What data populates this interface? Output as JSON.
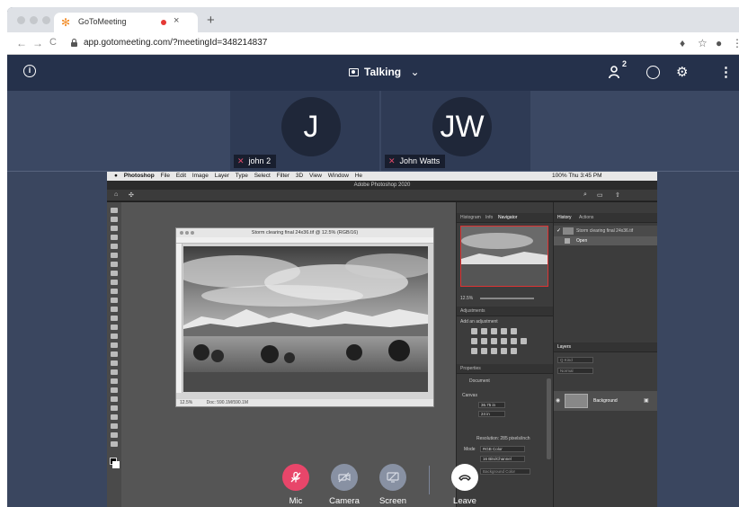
{
  "browser": {
    "tab_title": "GoToMeeting",
    "tab_close": "×",
    "new_tab": "+",
    "url": "app.gotomeeting.com/?meetingId=348214837",
    "nav": {
      "back": "←",
      "forward": "→",
      "reload": "C"
    },
    "actions": {
      "mic": "♦",
      "star": "☆",
      "account": "●",
      "menu": "⋮"
    }
  },
  "header": {
    "info": "i",
    "status_label": "Talking",
    "status_caret": "⌄",
    "participants_count": "2",
    "settings": "⚙",
    "more": "⋮"
  },
  "participants": [
    {
      "initials": "J",
      "name": "john 2",
      "mic_muted": true
    },
    {
      "initials": "JW",
      "name": "John Watts",
      "mic_muted": true
    }
  ],
  "shared_screen": {
    "menubar": [
      "Photoshop",
      "File",
      "Edit",
      "Image",
      "Layer",
      "Type",
      "Select",
      "Filter",
      "3D",
      "View",
      "Window",
      "He"
    ],
    "menubar_right": "100%  Thu 3:45 PM",
    "app_title": "Adobe Photoshop 2020",
    "doc_title": "Storm clearing final 24x36.tif @ 12.5% (RGB/16)",
    "doc_status_zoom": "12.5%",
    "doc_status_doc": "Doc: 590.1M/590.1M",
    "nav_tabs": [
      "Histogram",
      "Info",
      "Navigator"
    ],
    "nav_zoom": "12.5%",
    "adjustments_title": "Adjustments",
    "adjustments_hint": "Add an adjustment",
    "properties_title": "Properties",
    "properties_doc": "Document",
    "canvas_label": "Canvas",
    "canvas_w": "36.75 in",
    "canvas_h": "24 in",
    "resolution": "Resolution: 285 pixels/inch",
    "mode_label": "Mode",
    "mode_value": "RGB Color",
    "depth_value": "16 Bits/Channel",
    "bg_label": "Background Color",
    "history_tabs": [
      "History",
      "Actions"
    ],
    "history_items": [
      "Storm clearing final 24x36.tif",
      "Open"
    ],
    "layers_title": "Layers",
    "layer_name": "Background"
  },
  "controls": [
    {
      "label": "Mic",
      "color": "#e8466a",
      "state": "muted"
    },
    {
      "label": "Camera",
      "color": "#8891a3",
      "state": "off"
    },
    {
      "label": "Screen",
      "color": "#8891a3",
      "state": "sharing"
    },
    {
      "label": "Leave",
      "color": "#ffffff",
      "state": "end"
    }
  ],
  "colors": {
    "header_bg": "#25314b",
    "stage_bg": "#3a465f",
    "mute_red": "#e8466a"
  }
}
